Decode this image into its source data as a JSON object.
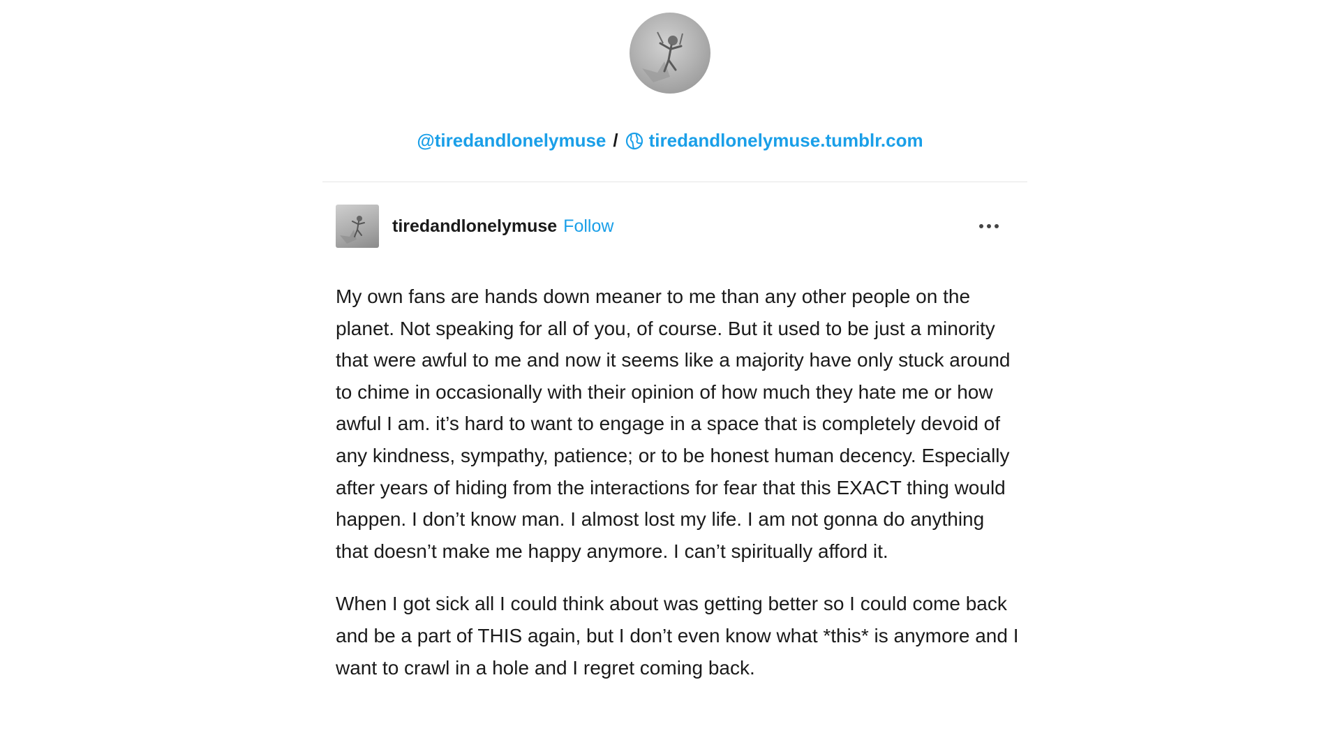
{
  "blog": {
    "handle": "@tiredandlonelymuse",
    "separator": "/",
    "url": "tiredandlonelymuse.tumblr.com",
    "globe_icon": "globe-icon",
    "avatar_icon": "avatar-image"
  },
  "post": {
    "username": "tiredandlonelymuse",
    "follow_label": "Follow",
    "more_icon": "ellipsis-icon",
    "paragraphs": [
      "My own fans are hands down meaner to me than any other people on the planet. Not speaking for all of you, of course. But it used to be just a minority that were awful to me and now it seems like a majority have only stuck around to chime in occasionally with their opinion of how much they hate me or how awful I am. it’s hard to want to engage in a space that is completely devoid of any kindness, sympathy, patience; or to be honest human decency. Especially after years of hiding from the interactions for fear that this EXACT thing would happen. I don’t know man. I almost lost my life. I am not gonna do anything that doesn’t make me happy anymore. I can’t spiritually afford it.",
      "When I got sick all I could think about was getting better so I could come back and be a part of THIS again, but I don’t even know what *this* is anymore and I want to crawl in a hole and I regret coming back."
    ]
  },
  "colors": {
    "link": "#1a9fe8",
    "text": "#1a1a1a",
    "divider": "#e6e6e6"
  }
}
